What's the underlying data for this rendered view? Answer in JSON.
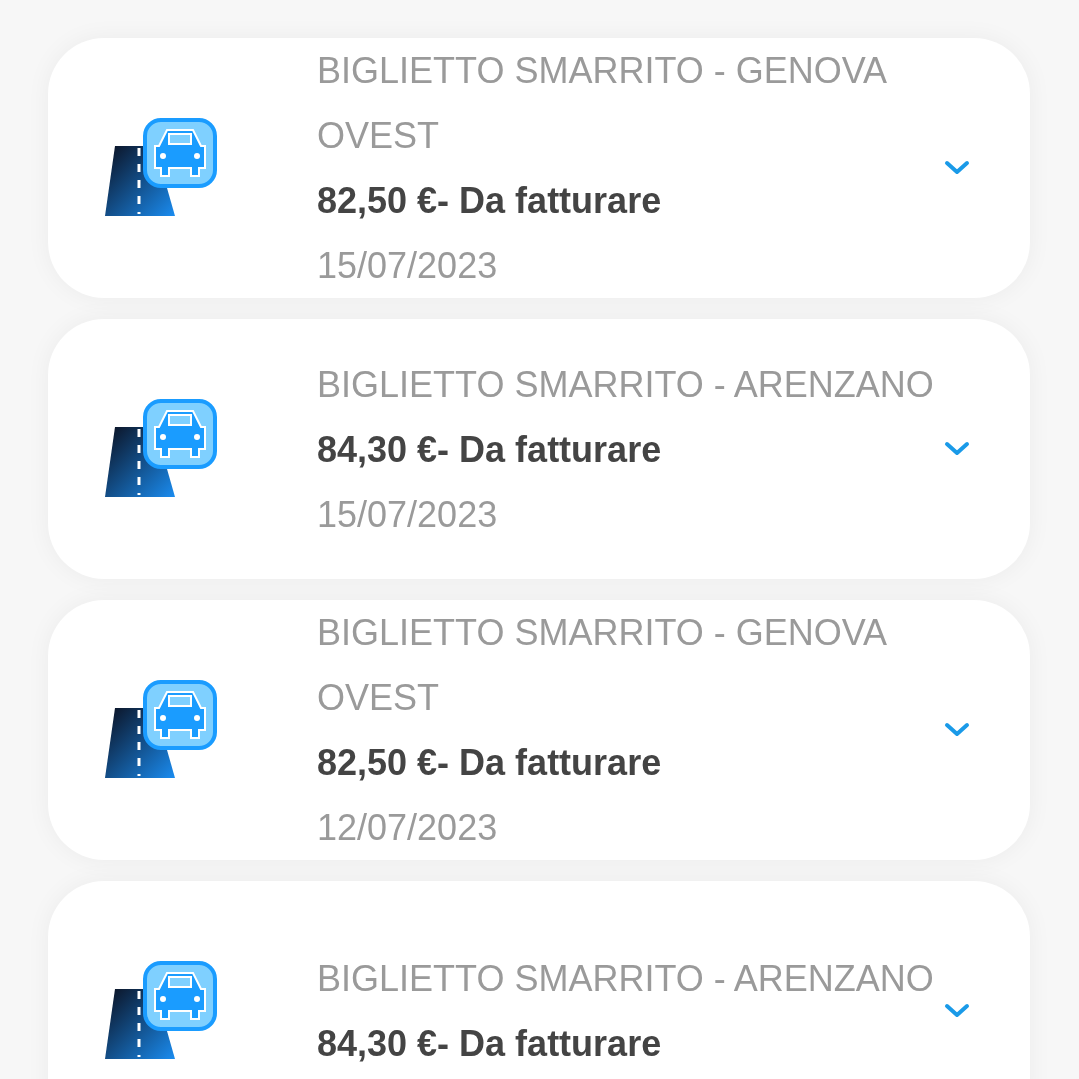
{
  "tickets": [
    {
      "title": "BIGLIETTO SMARRITO - GENOVA OVEST",
      "amount": "82,50 €- Da fatturare",
      "date": "15/07/2023",
      "expanded": false
    },
    {
      "title": "BIGLIETTO SMARRITO - ARENZANO",
      "amount": "84,30 €- Da fatturare",
      "date": "15/07/2023",
      "expanded": false
    },
    {
      "title": "BIGLIETTO SMARRITO - GENOVA OVEST",
      "amount": "82,50 €- Da fatturare",
      "date": "12/07/2023",
      "expanded": false
    },
    {
      "title": "BIGLIETTO SMARRITO - ARENZANO",
      "amount": "84,30 €- Da fatturare",
      "expanded": false
    }
  ]
}
